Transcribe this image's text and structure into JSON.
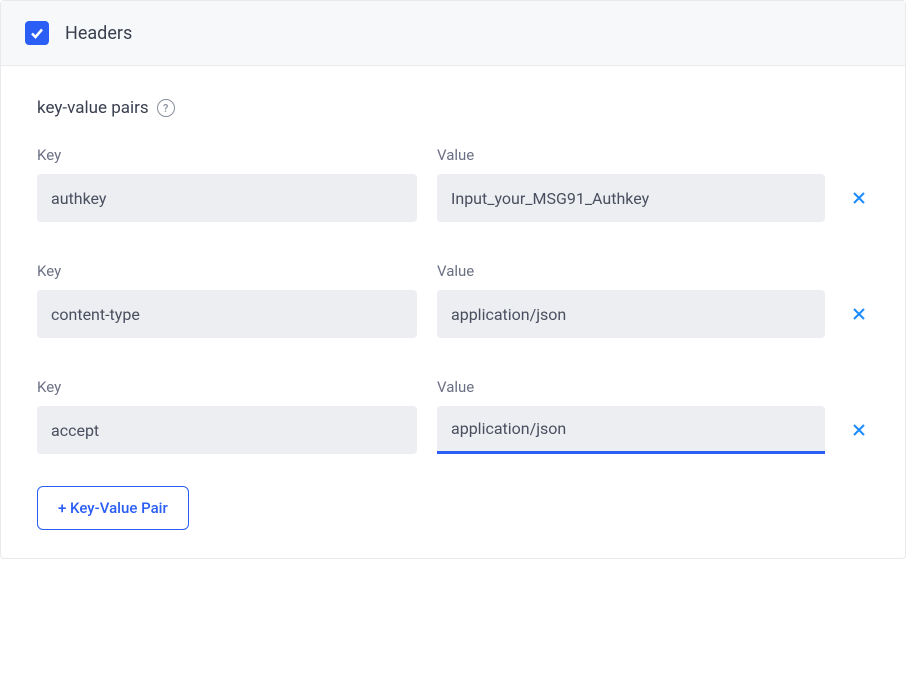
{
  "header": {
    "title": "Headers",
    "checked": true
  },
  "section": {
    "label": "key-value pairs"
  },
  "columns": {
    "key_label": "Key",
    "value_label": "Value"
  },
  "pairs": [
    {
      "key": "authkey",
      "value": "Input_your_MSG91_Authkey",
      "focused": false
    },
    {
      "key": "content-type",
      "value": "application/json",
      "focused": false
    },
    {
      "key": "accept",
      "value": "application/json",
      "focused": true
    }
  ],
  "actions": {
    "add_label": "+ Key-Value Pair"
  }
}
